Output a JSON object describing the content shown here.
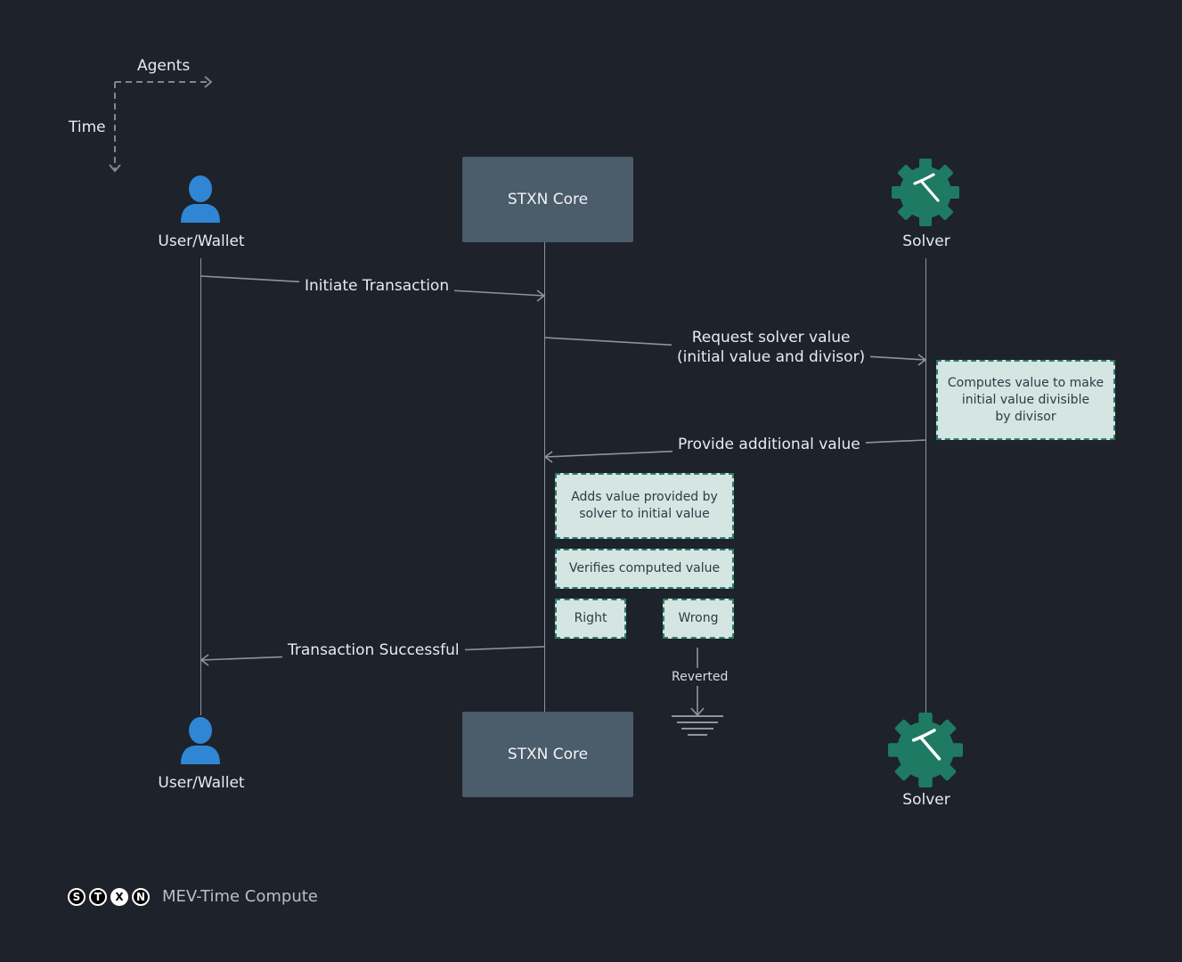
{
  "axes": {
    "horizontal_label": "Agents",
    "vertical_label": "Time"
  },
  "actors": {
    "user": {
      "label": "User/Wallet",
      "icon": "person-icon",
      "color": "#2f86d4"
    },
    "core": {
      "label": "STXN Core",
      "color": "#4b5c6b"
    },
    "solver": {
      "label": "Solver",
      "icon": "gear-pickaxe-icon",
      "color": "#1f7a63"
    }
  },
  "messages": [
    {
      "label": "Initiate Transaction",
      "from": "User/Wallet",
      "to": "STXN Core"
    },
    {
      "label_line1": "Request solver value",
      "label_line2": "(initial value and divisor)",
      "from": "STXN Core",
      "to": "Solver"
    },
    {
      "label": "Provide additional value",
      "from": "Solver",
      "to": "STXN Core"
    },
    {
      "label": "Transaction Successful",
      "from": "STXN Core",
      "to": "User/Wallet"
    }
  ],
  "notes": {
    "solver_compute": [
      "Computes value to make",
      "initial value divisible",
      "by divisor"
    ],
    "core_add": [
      "Adds value provided by",
      "solver to initial value"
    ],
    "core_verify": "Verifies computed value",
    "right": "Right",
    "wrong": "Wrong",
    "reverted": "Reverted"
  },
  "footer": {
    "logo_letters": [
      "S",
      "T",
      "X",
      "N"
    ],
    "title": "MEV-Time Compute"
  }
}
